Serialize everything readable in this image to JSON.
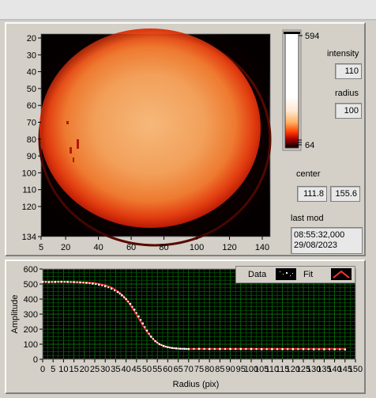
{
  "colors": {
    "panel": "#d4d0c8",
    "plot_bg": "#000000",
    "grid": "#00a000",
    "data_points": "#ffffff",
    "fit_line": "#ff2020"
  },
  "image": {
    "y_ticks": [
      "20",
      "30",
      "40",
      "50",
      "60",
      "70",
      "80",
      "90",
      "100",
      "110",
      "120",
      "134"
    ],
    "x_ticks": [
      "5",
      "20",
      "40",
      "60",
      "80",
      "100",
      "120",
      "140"
    ]
  },
  "colorbar": {
    "max_label": "594",
    "min_label": "64"
  },
  "controls": {
    "intensity_label": "intensity",
    "intensity_value": "110",
    "radius_label": "radius",
    "radius_value": "100",
    "center_label": "center",
    "center_x": "111.8",
    "center_y": "155.6",
    "last_mod_label": "last mod",
    "last_mod_time": "08:55:32,000",
    "last_mod_date": "29/08/2023"
  },
  "legend": {
    "data_label": "Data",
    "fit_label": "Fit"
  },
  "chart_data": {
    "type": "scatter",
    "xlabel": "Radius (pix)",
    "ylabel": "Amplitude",
    "xlim": [
      0,
      150
    ],
    "ylim": [
      0,
      600
    ],
    "x_ticks": [
      "0",
      "5",
      "10",
      "15",
      "20",
      "25",
      "30",
      "35",
      "40",
      "45",
      "50",
      "55",
      "60",
      "65",
      "70",
      "75",
      "80",
      "85",
      "90",
      "95",
      "100",
      "105",
      "110",
      "115",
      "120",
      "125",
      "130",
      "135",
      "140",
      "145",
      "150"
    ],
    "y_ticks": [
      "0",
      "100",
      "200",
      "300",
      "400",
      "500",
      "600"
    ],
    "series": [
      {
        "name": "Data",
        "x": [
          0,
          3,
          6,
          9,
          12,
          15,
          18,
          21,
          24,
          27,
          30,
          33,
          36,
          38,
          40,
          42,
          44,
          46,
          48,
          50,
          52,
          54,
          56,
          58,
          60,
          62,
          64,
          66,
          68,
          70,
          75,
          80,
          85,
          90,
          95,
          100,
          105,
          110,
          115,
          120,
          125,
          130,
          135,
          140,
          145
        ],
        "y": [
          515,
          513,
          514,
          515,
          514,
          513,
          511,
          508,
          503,
          496,
          486,
          470,
          447,
          425,
          400,
          368,
          330,
          285,
          238,
          190,
          150,
          120,
          100,
          88,
          80,
          75,
          72,
          70,
          69,
          68,
          69,
          68,
          68,
          68,
          68,
          68,
          67,
          67,
          67,
          67,
          67,
          66,
          66,
          66,
          65
        ]
      },
      {
        "name": "Fit",
        "x": [
          0,
          5,
          10,
          15,
          20,
          25,
          30,
          33,
          36,
          38,
          40,
          42,
          44,
          46,
          48,
          50,
          52,
          54,
          56,
          58,
          60,
          62,
          64,
          66,
          68,
          70,
          80,
          90,
          100,
          110,
          120,
          130,
          140,
          145
        ],
        "y": [
          515,
          515,
          515,
          514,
          512,
          507,
          493,
          478,
          452,
          430,
          400,
          362,
          318,
          272,
          226,
          183,
          148,
          121,
          101,
          88,
          80,
          75,
          72,
          70,
          69,
          68,
          68,
          68,
          68,
          68,
          68,
          68,
          68,
          68
        ]
      }
    ]
  }
}
